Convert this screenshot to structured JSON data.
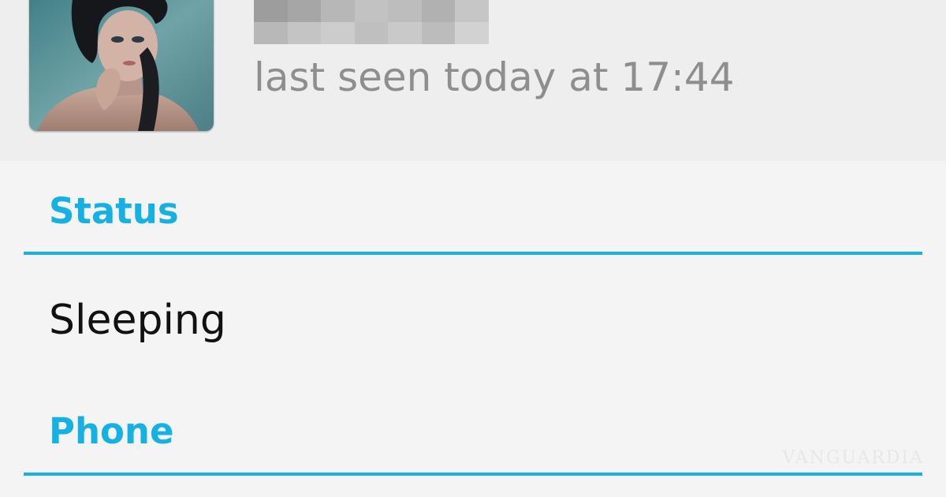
{
  "contact": {
    "avatar_alt": "contact photo",
    "name_pixel_colors": [
      "#9d9d9d",
      "#a6a6a6",
      "#b7b7b7",
      "#c2c2c2",
      "#bdbdbd",
      "#b1b1b1",
      "#c6c6c6",
      "#b8b8b8",
      "#c4c4c4",
      "#cccccc",
      "#bfbfbf",
      "#c9c9c9",
      "#bcbcbc",
      "#d2d2d2"
    ],
    "last_seen": "last seen today at 17:44"
  },
  "sections": {
    "status_label": "Status",
    "status_value": "Sleeping",
    "phone_label": "Phone"
  },
  "watermark": "VANGUARDIA",
  "colors": {
    "accent": "#16b1e3",
    "header_bg": "#eeeeee",
    "body_bg": "#f4f4f4",
    "secondary_text": "#8e8e8e"
  }
}
